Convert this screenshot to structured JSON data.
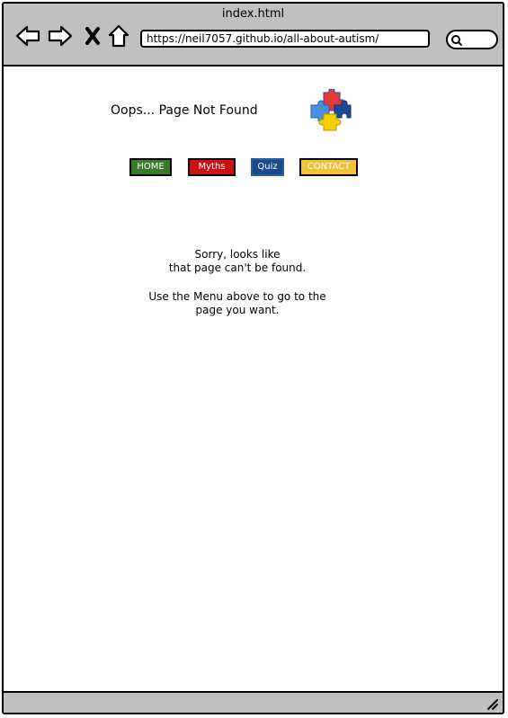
{
  "window": {
    "title": "index.html"
  },
  "browser": {
    "url": "https://neil7057.github.io/all-about-autism/"
  },
  "page": {
    "title": "Oops... Page Not Found",
    "menu": {
      "home": "HOME",
      "myths": "Myths",
      "quiz": "Quiz",
      "contact": "CONTACT"
    },
    "message": {
      "line1": "Sorry, looks like",
      "line2": "that page can't be found.",
      "line3": "Use the Menu above to go to the",
      "line4": "page you want."
    }
  },
  "colors": {
    "home": "#3a7a2a",
    "myths": "#cc1111",
    "quiz": "#1a4a8a",
    "contact": "#f2c13a",
    "chrome": "#c0c0c0"
  },
  "icons": [
    "back-arrow-icon",
    "forward-arrow-icon",
    "close-icon",
    "home-icon",
    "search-icon",
    "puzzle-logo-icon",
    "resize-grip-icon"
  ]
}
